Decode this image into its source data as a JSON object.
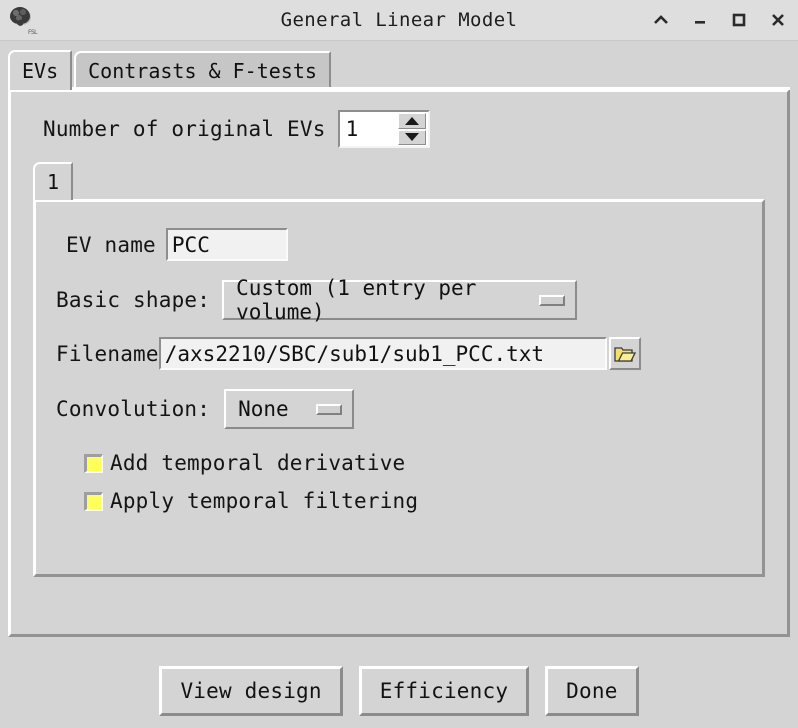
{
  "window": {
    "title": "General Linear Model",
    "logo_icon": "fsl-brain-logo",
    "controls": [
      {
        "name": "shade-button",
        "icon": "chevron-up-icon"
      },
      {
        "name": "minimize-button",
        "icon": "minimize-icon"
      },
      {
        "name": "maximize-button",
        "icon": "maximize-icon"
      },
      {
        "name": "close-button",
        "icon": "close-icon"
      }
    ]
  },
  "tabs": [
    {
      "label": "EVs",
      "active": true
    },
    {
      "label": "Contrasts & F-tests",
      "active": false
    }
  ],
  "evs_panel": {
    "num_evs_label": "Number of original EVs",
    "num_evs_value": "1",
    "ev_tabs": [
      {
        "label": "1",
        "active": true
      }
    ],
    "ev_name_label": "EV name",
    "ev_name_value": "PCC",
    "basic_shape_label": "Basic shape:",
    "basic_shape_value": "Custom (1 entry per volume)",
    "filename_label": "Filename",
    "filename_value": "/axs2210/SBC/sub1/sub1_PCC.txt",
    "browse_icon": "folder-open-icon",
    "convolution_label": "Convolution:",
    "convolution_value": "None",
    "checkboxes": [
      {
        "label": "Add temporal derivative",
        "checked": false
      },
      {
        "label": "Apply temporal filtering",
        "checked": false
      }
    ]
  },
  "footer": {
    "buttons": [
      {
        "label": "View design"
      },
      {
        "label": "Efficiency"
      },
      {
        "label": "Done"
      }
    ]
  },
  "colors": {
    "window_background": "#d4d4d4",
    "titlebar_background": "#dedede",
    "inactive_tab": "#c6c6c6",
    "entry_background": "#f1f1f1",
    "spin_entry_background": "#ffffff",
    "checkbox_fill": "#ffff5c",
    "folder_icon": "#f2e06a",
    "text": "#141414"
  }
}
